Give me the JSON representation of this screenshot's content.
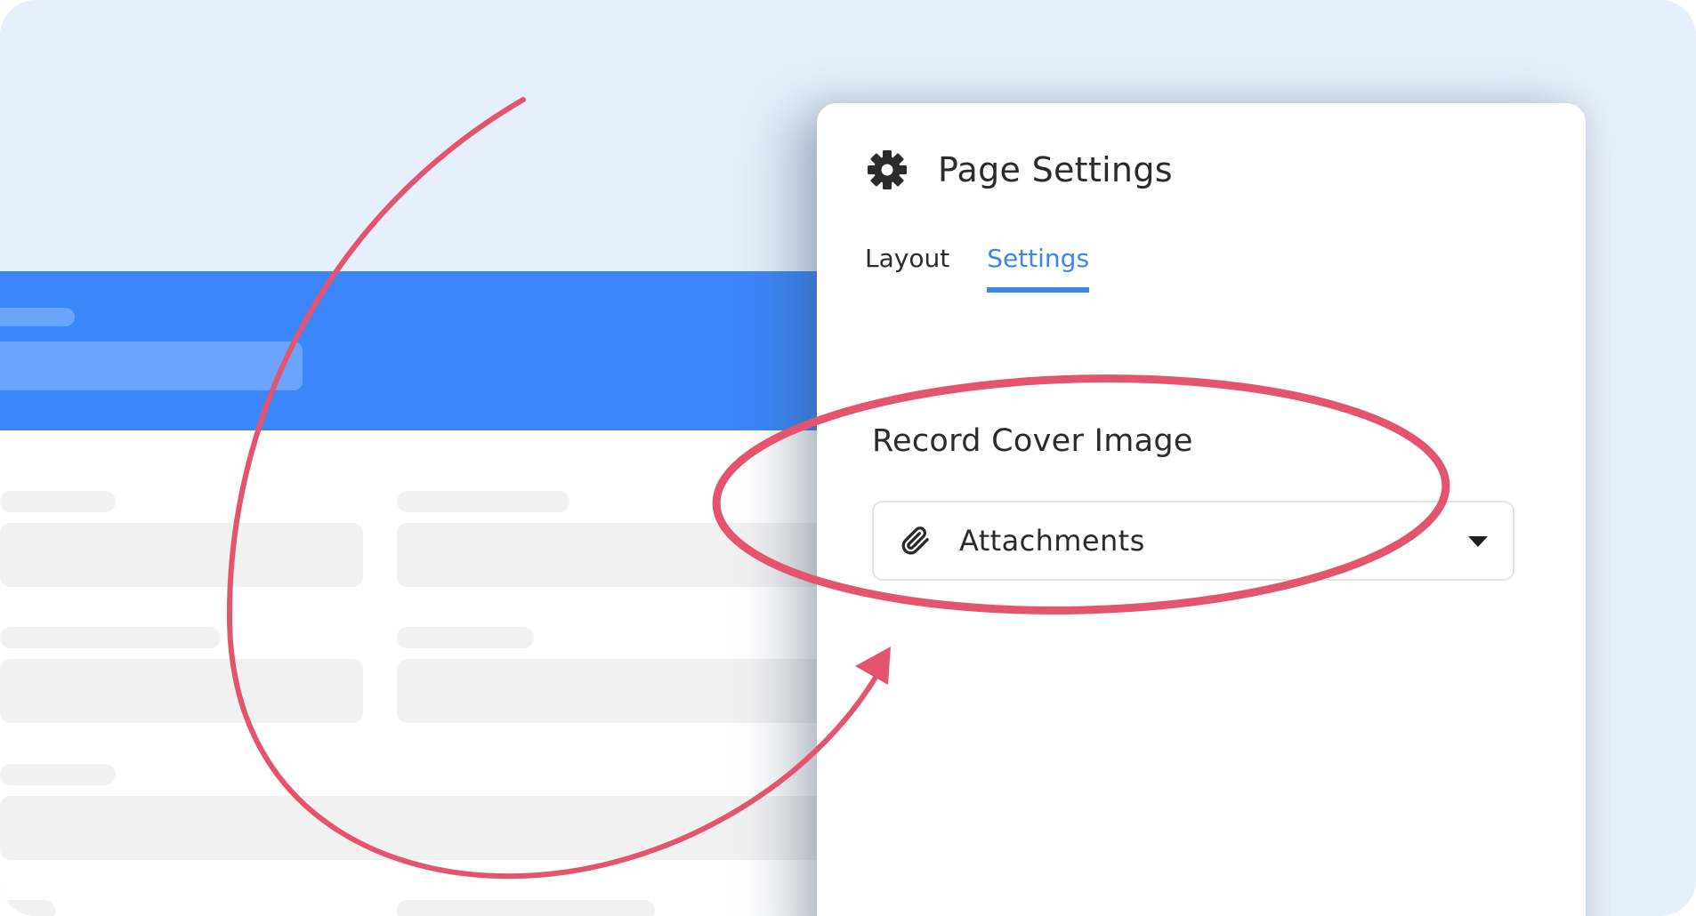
{
  "panel": {
    "title": "Page Settings",
    "icon": "gear-icon",
    "tabs": [
      {
        "label": "Layout",
        "active": false
      },
      {
        "label": "Settings",
        "active": true
      }
    ],
    "section_label": "Record Cover Image",
    "select": {
      "icon": "paperclip-icon",
      "value": "Attachments"
    }
  },
  "colors": {
    "accent": "#3c86ed",
    "header_blue": "#3b86fa",
    "annotation": "#e5546f",
    "background": "#e6effc"
  }
}
